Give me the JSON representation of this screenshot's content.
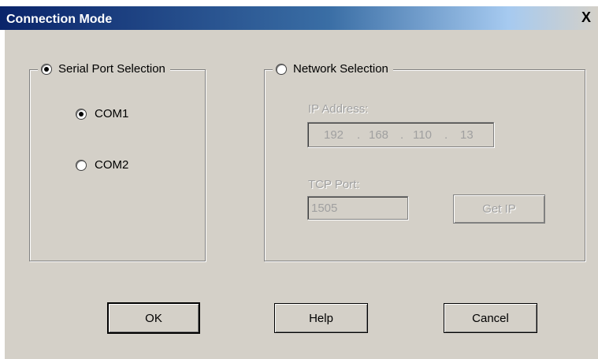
{
  "window": {
    "title": "Connection Mode",
    "close_glyph": "X"
  },
  "serial": {
    "legend": "Serial Port Selection",
    "options": [
      {
        "label": "COM1",
        "checked": true
      },
      {
        "label": "COM2",
        "checked": false
      }
    ]
  },
  "network": {
    "legend": "Network Selection",
    "ip_label": "IP Address:",
    "ip_octets": [
      "192",
      "168",
      "110",
      "13"
    ],
    "ip_separator": ".",
    "tcp_label": "TCP Port:",
    "tcp_value": "1505",
    "get_ip_label": "Get IP"
  },
  "buttons": {
    "ok": "OK",
    "help": "Help",
    "cancel": "Cancel"
  }
}
